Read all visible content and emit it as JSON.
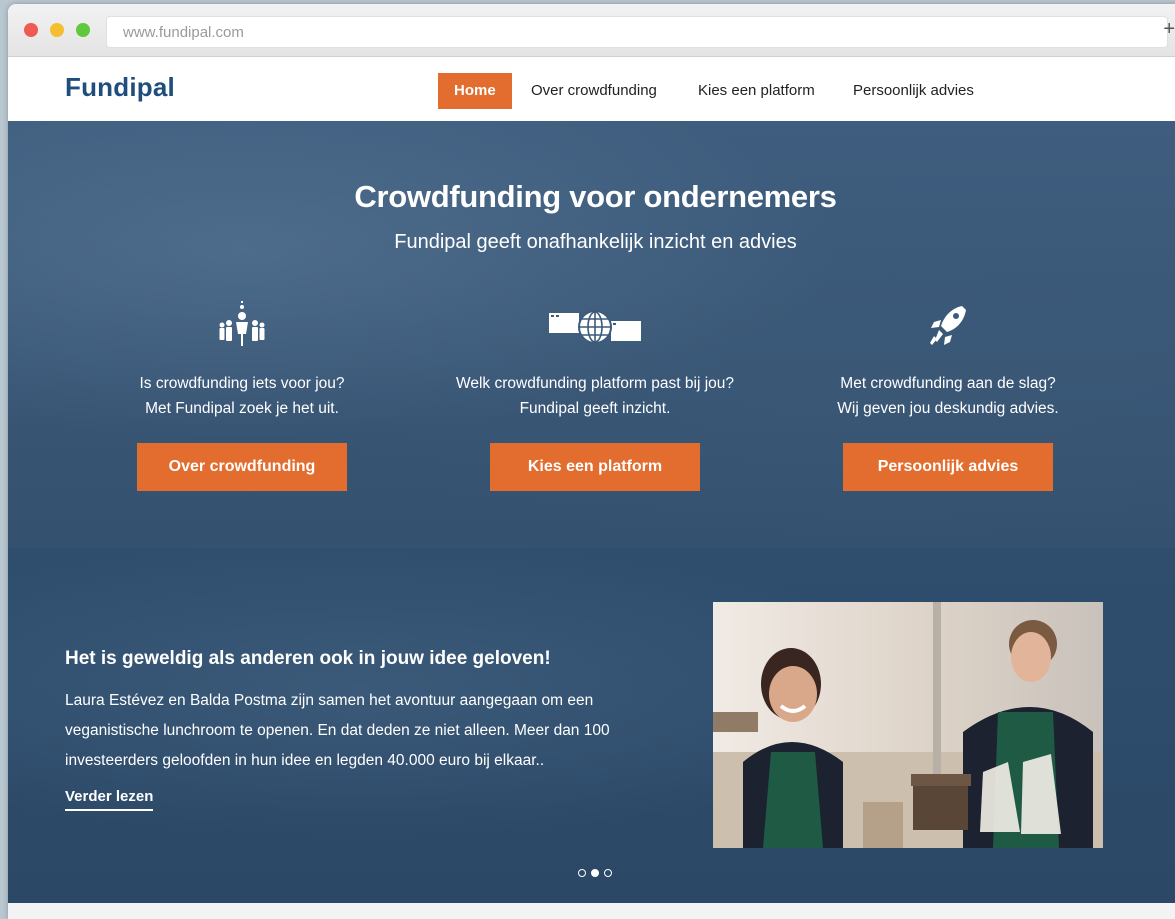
{
  "browser": {
    "url": "www.fundipal.com",
    "new_tab": "+"
  },
  "nav": {
    "logo": "Fundipal",
    "items": [
      {
        "label": "Home",
        "active": true
      },
      {
        "label": "Over crowdfunding",
        "active": false
      },
      {
        "label": "Kies een platform",
        "active": false
      },
      {
        "label": "Persoonlijk advies",
        "active": false
      }
    ]
  },
  "hero": {
    "title": "Crowdfunding voor ondernemers",
    "subtitle": "Fundipal geeft onafhankelijk inzicht en advies",
    "features": [
      {
        "icon": "people-idea-icon",
        "line1": "Is crowdfunding iets voor jou?",
        "line2": "Met Fundipal zoek je het uit.",
        "button": "Over crowdfunding"
      },
      {
        "icon": "globe-platform-icon",
        "line1": "Welk crowdfunding platform past bij jou?",
        "line2": "Fundipal geeft inzicht.",
        "button": "Kies een platform"
      },
      {
        "icon": "rocket-icon",
        "line1": "Met crowdfunding aan de slag?",
        "line2": "Wij geven jou deskundig advies.",
        "button": "Persoonlijk advies"
      }
    ]
  },
  "story": {
    "title": "Het is geweldig als anderen ook in jouw idee geloven!",
    "body": "Laura Estévez en Balda Postma zijn samen het avontuur aangegaan om een veganistische lunchroom te openen. En dat deden ze niet alleen. Meer dan 100 investeerders geloofden in hun idee en legden 40.000 euro bij elkaar..",
    "link": "Verder lezen",
    "carousel_active": 2,
    "carousel_count": 3
  },
  "colors": {
    "accent": "#e26d2e",
    "brand": "#1f4e7d"
  }
}
